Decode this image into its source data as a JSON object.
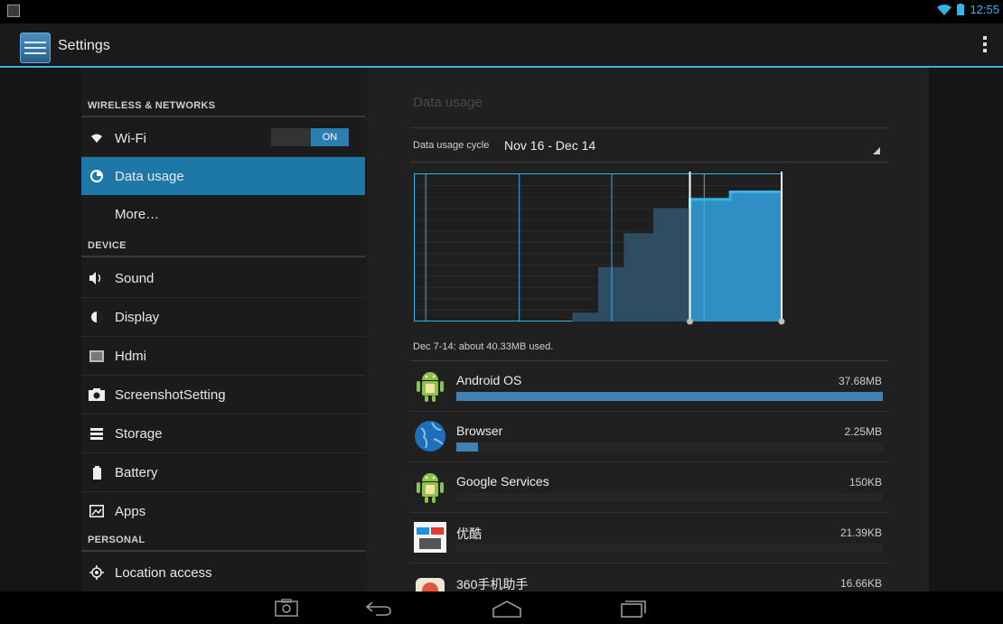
{
  "status_bar": {
    "time": "12:55"
  },
  "action_bar": {
    "title": "Settings"
  },
  "sidebar": {
    "sections": [
      {
        "header": "WIRELESS & NETWORKS"
      },
      {
        "header": "DEVICE"
      },
      {
        "header": "PERSONAL"
      }
    ],
    "items": [
      {
        "label": "Wi-Fi",
        "icon": "wifi-icon",
        "toggle": "ON"
      },
      {
        "label": "Data usage",
        "icon": "data-usage-icon",
        "selected": true
      },
      {
        "label": "More…",
        "icon": ""
      },
      {
        "label": "Sound",
        "icon": "speaker-icon"
      },
      {
        "label": "Display",
        "icon": "brightness-icon"
      },
      {
        "label": "Hdmi",
        "icon": "hdmi-icon"
      },
      {
        "label": "ScreenshotSetting",
        "icon": "camera-icon"
      },
      {
        "label": "Storage",
        "icon": "storage-icon"
      },
      {
        "label": "Battery",
        "icon": "battery-icon"
      },
      {
        "label": "Apps",
        "icon": "apps-icon"
      },
      {
        "label": "Location access",
        "icon": "location-icon"
      }
    ]
  },
  "data_usage": {
    "title": "Data usage",
    "cycle_label": "Data usage cycle",
    "cycle_value": "Nov 16 - Dec 14",
    "summary": "Dec 7-14: about 40.33MB used.",
    "apps": [
      {
        "name": "Android OS",
        "size": "37.68MB",
        "fraction": 1.0,
        "icon": "android-icon"
      },
      {
        "name": "Browser",
        "size": "2.25MB",
        "fraction": 0.05,
        "icon": "browser-globe-icon"
      },
      {
        "name": "Google Services",
        "size": "150KB",
        "fraction": 0.0,
        "icon": "android-icon"
      },
      {
        "name": "优酷",
        "size": "21.39KB",
        "fraction": 0.0,
        "icon": "youku-icon"
      },
      {
        "name": "360手机助手",
        "size": "16.66KB",
        "fraction": 0.0,
        "icon": "360-icon"
      }
    ]
  },
  "chart_data": {
    "type": "area",
    "x": [
      0,
      0.43,
      0.43,
      0.5,
      0.5,
      0.57,
      0.57,
      0.65,
      0.65,
      0.75,
      0.75,
      0.86,
      0.86,
      1.0
    ],
    "y": [
      0,
      0,
      0.06,
      0.06,
      0.37,
      0.37,
      0.6,
      0.6,
      0.77,
      0.77,
      0.83,
      0.83,
      0.88,
      0.88
    ],
    "range_start": 0.75,
    "range_end": 1.0,
    "grid": true
  },
  "colors": {
    "accent": "#33b5e5",
    "selected": "#1d78a8",
    "bar": "#3f82b3"
  },
  "nav_bar": {
    "buttons": [
      "screenshot-icon",
      "back-icon",
      "home-icon",
      "recents-icon"
    ]
  }
}
